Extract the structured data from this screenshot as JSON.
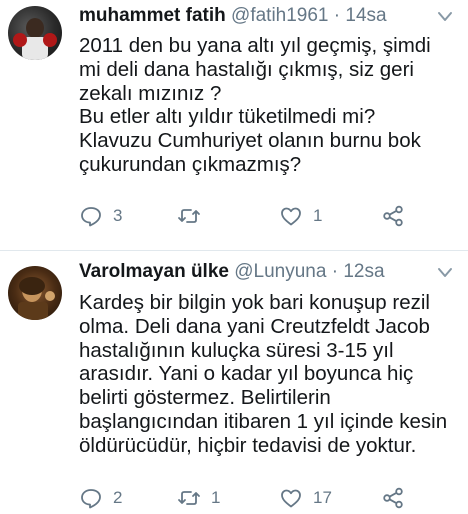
{
  "tweets": [
    {
      "name": "muhammet fatih",
      "handle": "@fatih1961",
      "separator": "·",
      "time": "14sa",
      "lines": [
        "2011 den bu yana altı yıl geçmiş, şimdi",
        "mi deli dana hastalığı çıkmış, siz geri",
        "zekalı mızınız ?",
        "Bu etler altı yıldır tüketilmedi mi?",
        "Klavuzu Cumhuriyet olanın burnu bok",
        "çukurundan çıkmazmış?"
      ],
      "reply_count": "3",
      "retweet_count": "",
      "like_count": "1"
    },
    {
      "name": "Varolmayan ülke",
      "handle": "@Lunyuna",
      "separator": "·",
      "time": "12sa",
      "lines": [
        "Kardeş bir bilgin yok bari konuşup rezil",
        "olma. Deli dana yani Creutzfeldt Jacob",
        "hastalığının kuluçka süresi 3-15 yıl",
        "arasıdır. Yani o kadar yıl boyunca hiç",
        "belirti göstermez. Belirtilerin",
        "başlangıcından itibaren 1 yıl içinde kesin",
        "öldürücüdür, hiçbir tedavisi de yoktur."
      ],
      "reply_count": "2",
      "retweet_count": "1",
      "like_count": "17"
    }
  ],
  "colors": {
    "text": "#14171a",
    "muted": "#657786",
    "divider": "#e1e8ed"
  },
  "icons": [
    "reply-icon",
    "retweet-icon",
    "like-icon",
    "share-icon",
    "chevron-down-icon"
  ]
}
